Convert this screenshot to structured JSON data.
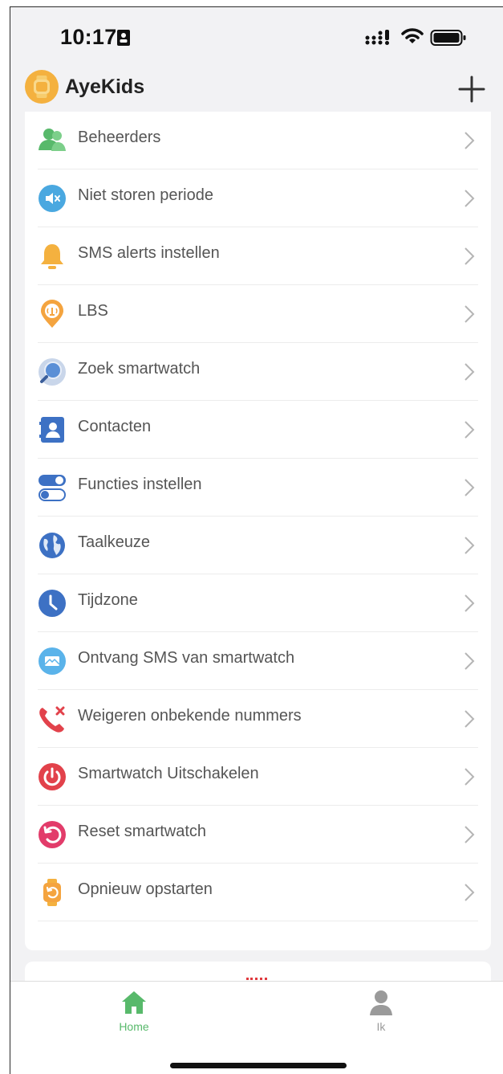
{
  "status_bar": {
    "time": "10:17"
  },
  "header": {
    "app_title": "AyeKids"
  },
  "menu": {
    "items": [
      {
        "label": "Beheerders",
        "icon": "admins-icon"
      },
      {
        "label": "Niet storen periode",
        "icon": "mute-icon"
      },
      {
        "label": "SMS alerts instellen",
        "icon": "bell-icon"
      },
      {
        "label": "LBS",
        "icon": "location-pin-icon"
      },
      {
        "label": "Zoek smartwatch",
        "icon": "search-icon"
      },
      {
        "label": "Contacten",
        "icon": "contacts-icon"
      },
      {
        "label": "Functies instellen",
        "icon": "toggles-icon"
      },
      {
        "label": "Taalkeuze",
        "icon": "globe-icon"
      },
      {
        "label": "Tijdzone",
        "icon": "clock-icon"
      },
      {
        "label": "Ontvang SMS van smartwatch",
        "icon": "message-icon"
      },
      {
        "label": "Weigeren onbekende nummers",
        "icon": "reject-call-icon"
      },
      {
        "label": "Smartwatch Uitschakelen",
        "icon": "power-icon"
      },
      {
        "label": "Reset smartwatch",
        "icon": "reset-icon"
      },
      {
        "label": "Opnieuw opstarten",
        "icon": "restart-watch-icon"
      }
    ]
  },
  "tabbar": {
    "home_label": "Home",
    "me_label": "Ik"
  },
  "colors": {
    "accent_green": "#58b96b",
    "inactive_gray": "#9a9a9a",
    "chevron_gray": "#b5b5b5"
  }
}
